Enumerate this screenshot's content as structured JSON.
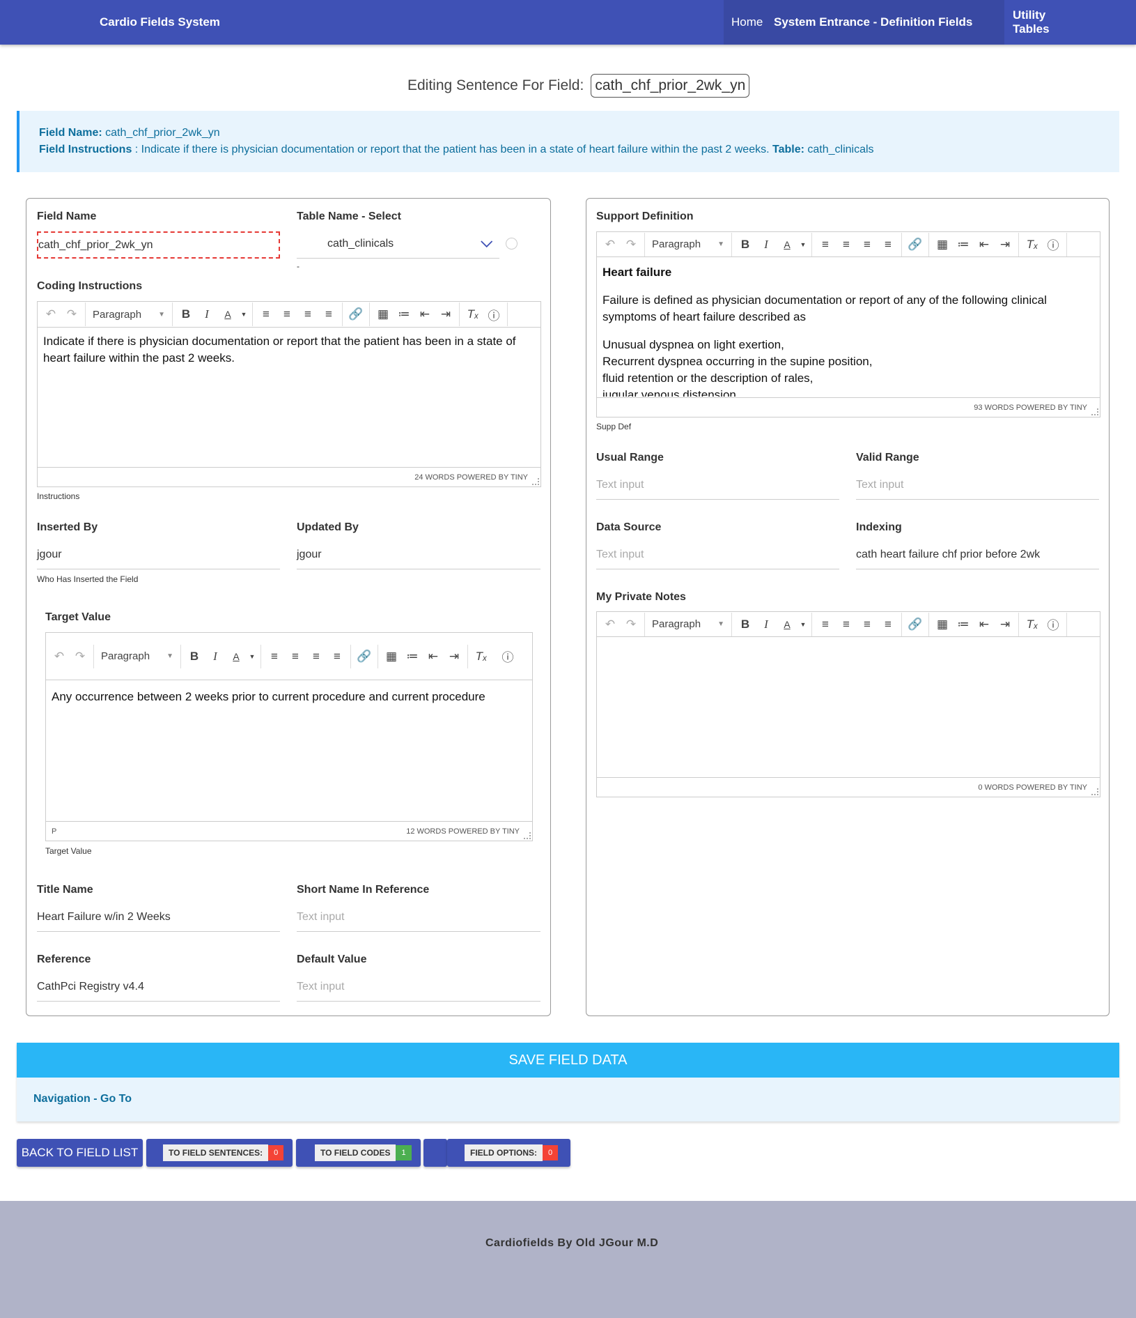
{
  "nav": {
    "brand": "Cardio Fields System",
    "links": [
      "Home",
      "System Entrance - Definition Fields",
      "Utility Tables"
    ]
  },
  "editing": {
    "label": "Editing Sentence For Field:",
    "field": "cath_chf_prior_2wk_yn"
  },
  "info": {
    "field_name_label": "Field Name:",
    "field_name": "cath_chf_prior_2wk_yn",
    "instructions_label": "Field Instructions",
    "instructions": " : Indicate if there is physician documentation or report that the patient has been in a state of heart failure within the past 2 weeks.",
    "table_label": "Table:",
    "table": "cath_clinicals"
  },
  "left": {
    "field_name_label": "Field Name",
    "field_name_value": "cath_chf_prior_2wk_yn",
    "table_select_label": "Table Name - Select",
    "table_select_value": "cath_clinicals",
    "table_select_helper": "-",
    "coding_label": "Coding Instructions",
    "coding_text": "Indicate if there is physician documentation or report that the patient has been in a state of heart failure within the past 2 weeks.",
    "coding_words": "24 WORDS POWERED BY TINY",
    "coding_helper": "Instructions",
    "inserted_by_label": "Inserted By",
    "inserted_by_value": "jgour",
    "inserted_by_helper": "Who Has Inserted the Field",
    "updated_by_label": "Updated By",
    "updated_by_value": "jgour",
    "target_label": "Target Value",
    "target_text": "Any occurrence between 2 weeks prior to current procedure and current procedure",
    "target_words": "12 WORDS POWERED BY TINY",
    "target_path": "P",
    "target_helper": "Target Value",
    "title_name_label": "Title Name",
    "title_name_value": "Heart Failure w/in 2 Weeks",
    "short_name_label": "Short Name In Reference",
    "short_name_placeholder": "Text input",
    "reference_label": "Reference",
    "reference_value": "CathPci Registry v4.4",
    "default_label": "Default Value",
    "default_placeholder": "Text input"
  },
  "right": {
    "support_label": "Support Definition",
    "support_heading": "Heart failure",
    "support_p1": "Failure is defined as physician documentation or report of any of the following clinical symptoms of heart failure described as",
    "support_l1": "Unusual dyspnea on light exertion,",
    "support_l2": "Recurrent dyspnea occurring in the supine position,",
    "support_l3": "fluid retention  or the description of rales,",
    "support_l4": "jugular venous distension,",
    "support_words": "93 WORDS POWERED BY TINY",
    "support_helper": "Supp Def",
    "usual_label": "Usual Range",
    "usual_placeholder": "Text input",
    "valid_label": "Valid Range",
    "valid_placeholder": "Text input",
    "source_label": "Data Source",
    "source_placeholder": "Text input",
    "indexing_label": "Indexing",
    "indexing_value": "cath heart failure chf prior before 2wk",
    "notes_label": "My Private Notes",
    "notes_words": "0 WORDS POWERED BY TINY"
  },
  "toolbar": {
    "block_format": "Paragraph"
  },
  "actions": {
    "save": "SAVE FIELD DATA",
    "navigation": "Navigation - Go To",
    "back": "BACK TO FIELD LIST",
    "sentences": "TO FIELD SENTENCES:",
    "sentences_count": "0",
    "codes": "TO FIELD CODES",
    "codes_count": "1",
    "options": "FIELD OPTIONS:",
    "options_count": "0"
  },
  "footer": {
    "text": "Cardiofields By Old JGour M.D"
  }
}
